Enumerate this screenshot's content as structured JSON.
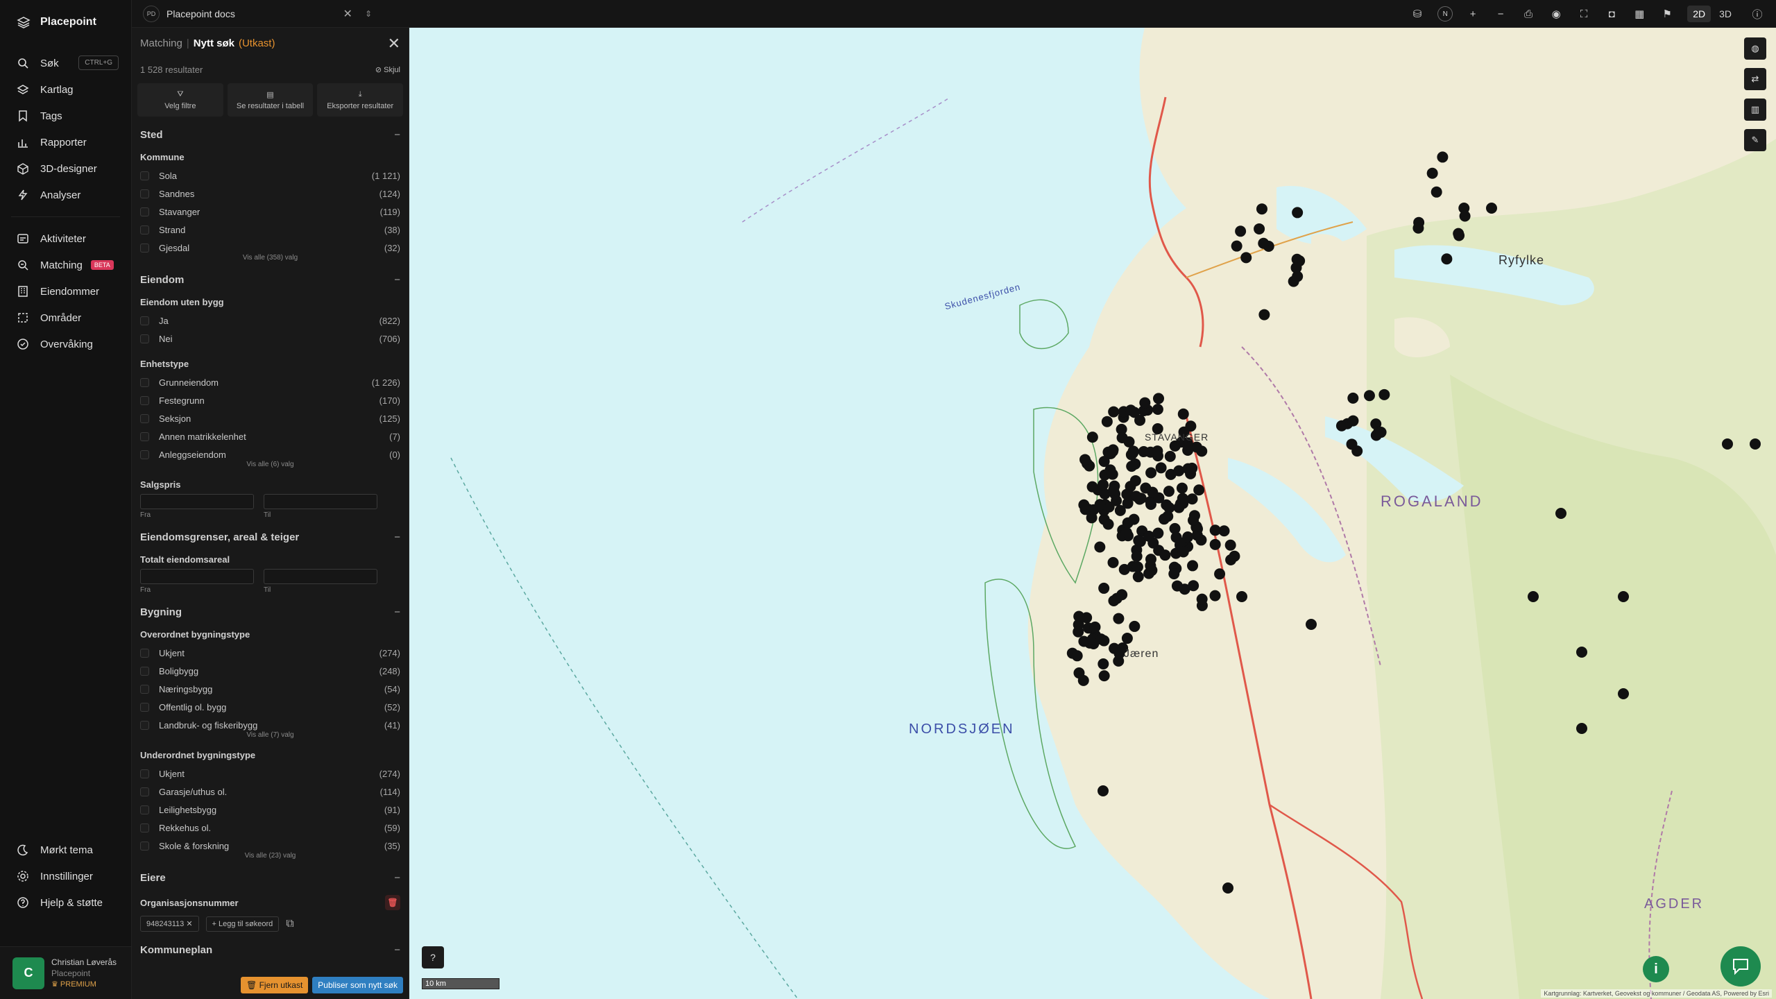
{
  "app": {
    "name": "Placepoint"
  },
  "sidebar": {
    "search_shortcut": "CTRL+G",
    "items": [
      {
        "label": "Søk",
        "icon": "search-icon"
      },
      {
        "label": "Kartlag",
        "icon": "layers-icon"
      },
      {
        "label": "Tags",
        "icon": "bookmark-icon"
      },
      {
        "label": "Rapporter",
        "icon": "chart-icon"
      },
      {
        "label": "3D-designer",
        "icon": "cube-icon"
      },
      {
        "label": "Analyser",
        "icon": "bolt-icon"
      }
    ],
    "items2": [
      {
        "label": "Aktiviteter",
        "icon": "activity-icon"
      },
      {
        "label": "Matching",
        "icon": "match-icon",
        "badge": "BETA"
      },
      {
        "label": "Eiendommer",
        "icon": "building-icon"
      },
      {
        "label": "Områder",
        "icon": "area-icon"
      },
      {
        "label": "Overvåking",
        "icon": "monitor-icon"
      }
    ],
    "bottom": [
      {
        "label": "Mørkt tema",
        "icon": "moon-icon"
      },
      {
        "label": "Innstillinger",
        "icon": "gear-icon"
      },
      {
        "label": "Hjelp & støtte",
        "icon": "help-icon"
      }
    ],
    "user": {
      "initial": "C",
      "name": "Christian Løverås",
      "org": "Placepoint",
      "plan": "PREMIUM"
    }
  },
  "topbar": {
    "doc_badge": "PD",
    "doc_title": "Placepoint docs",
    "mode_2d": "2D",
    "mode_3d": "3D",
    "compass": "N"
  },
  "panel": {
    "crumb": "Matching",
    "title": "Nytt søk",
    "status": "(Utkast)",
    "results": "1 528 resultater",
    "hide": "Skjul",
    "actions": [
      "Velg filtre",
      "Se resultater i tabell",
      "Eksporter resultater"
    ],
    "sted": {
      "title": "Sted",
      "kommune_title": "Kommune",
      "kommune": [
        {
          "label": "Sola",
          "count": "(1 121)"
        },
        {
          "label": "Sandnes",
          "count": "(124)"
        },
        {
          "label": "Stavanger",
          "count": "(119)"
        },
        {
          "label": "Strand",
          "count": "(38)"
        },
        {
          "label": "Gjesdal",
          "count": "(32)"
        }
      ],
      "show_all": "Vis alle (358) valg"
    },
    "eiendom": {
      "title": "Eiendom",
      "uten_bygg_title": "Eiendom uten bygg",
      "uten_bygg": [
        {
          "label": "Ja",
          "count": "(822)"
        },
        {
          "label": "Nei",
          "count": "(706)"
        }
      ],
      "enhetstype_title": "Enhetstype",
      "enhetstype": [
        {
          "label": "Grunneiendom",
          "count": "(1 226)"
        },
        {
          "label": "Festegrunn",
          "count": "(170)"
        },
        {
          "label": "Seksjon",
          "count": "(125)"
        },
        {
          "label": "Annen matrikkelenhet",
          "count": "(7)"
        },
        {
          "label": "Anleggseiendom",
          "count": "(0)"
        }
      ],
      "enhetstype_show_all": "Vis alle (6) valg",
      "salgspris_title": "Salgspris",
      "from": "Fra",
      "to": "Til"
    },
    "grenser": {
      "title": "Eiendomsgrenser, areal & teiger",
      "areal_title": "Totalt eiendomsareal",
      "from": "Fra",
      "to": "Til"
    },
    "bygning": {
      "title": "Bygning",
      "overordnet_title": "Overordnet bygningstype",
      "overordnet": [
        {
          "label": "Ukjent",
          "count": "(274)"
        },
        {
          "label": "Boligbygg",
          "count": "(248)"
        },
        {
          "label": "Næringsbygg",
          "count": "(54)"
        },
        {
          "label": "Offentlig ol. bygg",
          "count": "(52)"
        },
        {
          "label": "Landbruk- og fiskeribygg",
          "count": "(41)"
        }
      ],
      "overordnet_show_all": "Vis alle (7) valg",
      "underordnet_title": "Underordnet bygningstype",
      "underordnet": [
        {
          "label": "Ukjent",
          "count": "(274)"
        },
        {
          "label": "Garasje/uthus ol.",
          "count": "(114)"
        },
        {
          "label": "Leilighetsbygg",
          "count": "(91)"
        },
        {
          "label": "Rekkehus ol.",
          "count": "(59)"
        },
        {
          "label": "Skole & forskning",
          "count": "(35)"
        }
      ],
      "underordnet_show_all": "Vis alle (23) valg"
    },
    "eiere": {
      "title": "Eiere",
      "org_title": "Organisasjonsnummer",
      "org_value": "948243113",
      "add_keyword": "Legg til søkeord"
    },
    "kommuneplan": {
      "title": "Kommuneplan"
    },
    "remove_draft": "Fjern utkast",
    "publish": "Publiser som nytt søk"
  },
  "map": {
    "scale": "10 km",
    "labels": {
      "nordsjoen": "NORDSJØEN",
      "rogaland": "ROGALAND",
      "stavanger": "STAVANGER",
      "ryfylke": "Ryfylke",
      "agder": "AGDER",
      "jaeren": "Jæren",
      "skudenesfjorden": "Skudenesfjorden"
    },
    "attribution": "Kartgrunnlag: Kartverket, Geovekst og kommuner / Geodata AS, Powered by Esri"
  }
}
